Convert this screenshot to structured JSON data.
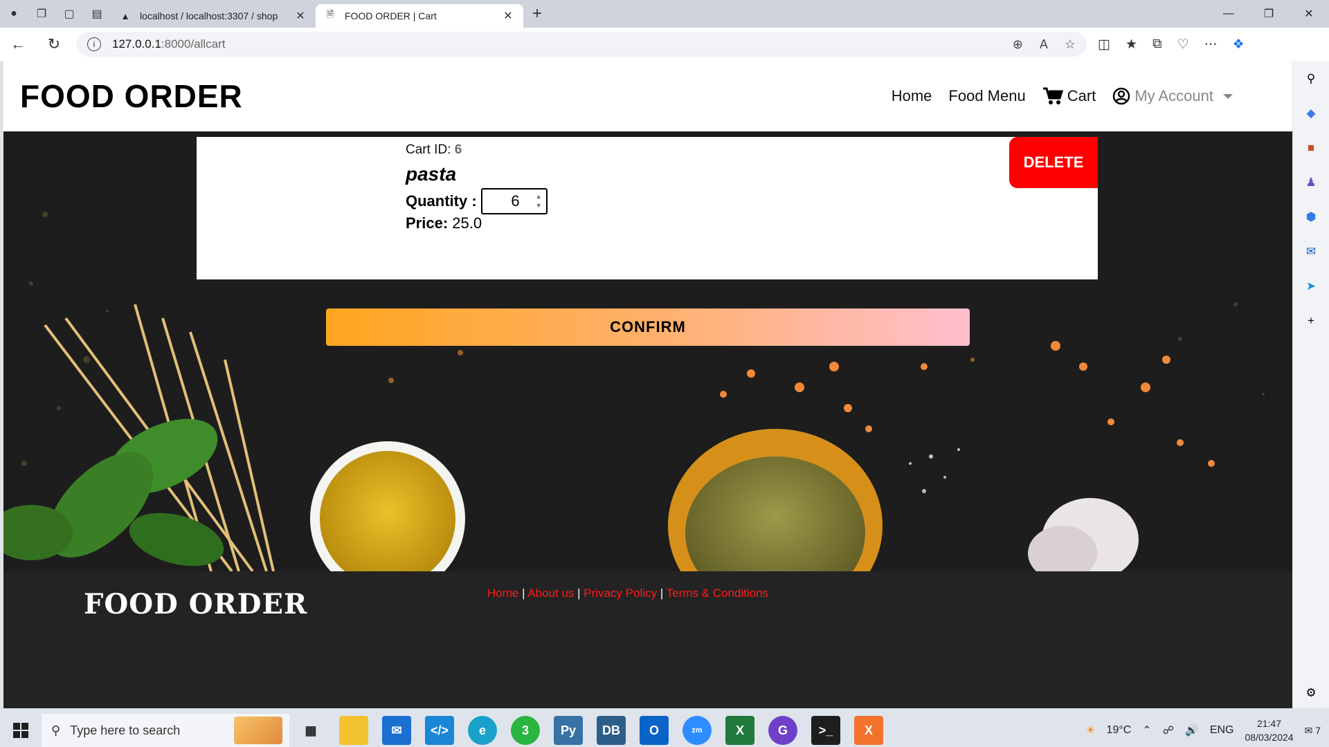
{
  "browser": {
    "tabs": [
      {
        "title": "localhost / localhost:3307 / shop",
        "active": false
      },
      {
        "title": "FOOD ORDER | Cart",
        "active": true
      }
    ],
    "url_host": "127.0.0.1",
    "url_path": ":8000/allcart"
  },
  "site": {
    "logo": "FOOD ORDER",
    "nav": {
      "home": "Home",
      "food_menu": "Food Menu",
      "cart": "Cart",
      "account": "My Account"
    }
  },
  "cart_item": {
    "cart_id_label": "Cart ID:",
    "cart_id": "6",
    "name": "pasta",
    "quantity_label": "Quantity :",
    "quantity": "6",
    "price_label": "Price:",
    "price": "25.0",
    "delete_label": "DELETE"
  },
  "confirm_label": "CONFIRM",
  "footer": {
    "logo": "FOOD ORDER",
    "links": [
      "Home",
      "About us",
      "Privacy Policy",
      "Terms & Conditions"
    ]
  },
  "taskbar": {
    "search_placeholder": "Type here to search",
    "weather": "19°C",
    "language": "ENG",
    "time": "21:47",
    "date": "08/03/2024",
    "whatsapp_badge": "3",
    "notification_count": "7"
  },
  "colors": {
    "delete": "#ff0000",
    "footer_link": "#ff1a1a",
    "confirm_start": "#ffa61f",
    "confirm_end": "#ffbfd0"
  }
}
